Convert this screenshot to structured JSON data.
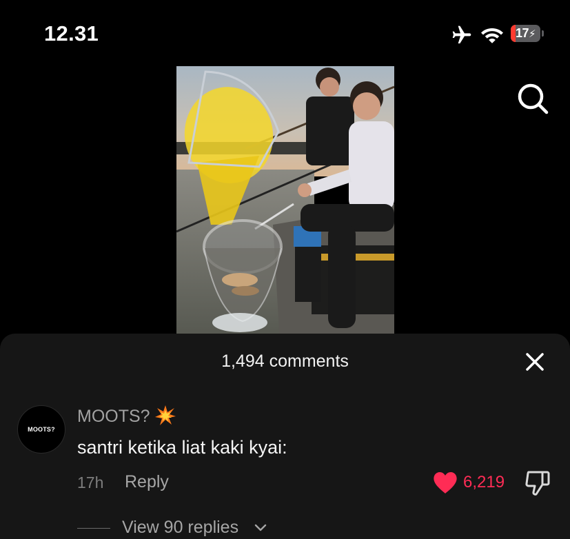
{
  "status_bar": {
    "time": "12.31",
    "battery_level": "17",
    "battery_fraction": 0.17,
    "icons": [
      "airplane-icon",
      "wifi-icon",
      "battery-charging-icon"
    ]
  },
  "header": {
    "search_icon": "search-icon"
  },
  "video": {
    "description_icon": "video-thumbnail"
  },
  "comments": {
    "title": "1,494 comments",
    "close_icon": "close-icon",
    "items": [
      {
        "avatar_text": "MOOTS?",
        "author": "MOOTS?",
        "author_emoji": "collision-emoji",
        "text": "santri ketika liat kaki kyai:",
        "time": "17h",
        "reply_label": "Reply",
        "likes": "6,219",
        "liked": true,
        "view_replies": "View 90 replies"
      }
    ]
  },
  "colors": {
    "background": "#000000",
    "sheet": "#161616",
    "like_accent": "#ff2c55",
    "battery_low": "#ff3b30",
    "muted_text": "#a6a6a6"
  }
}
